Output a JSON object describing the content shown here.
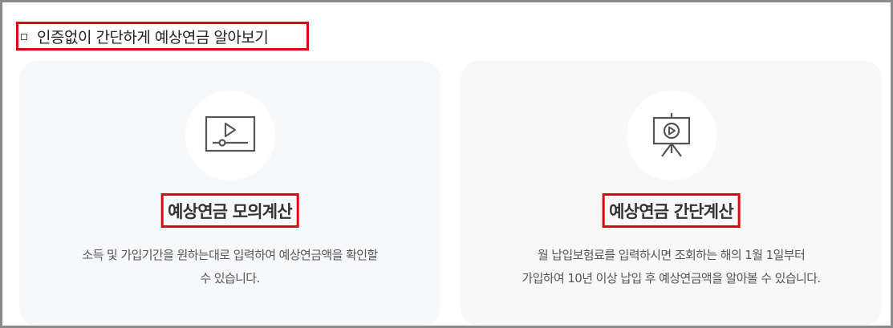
{
  "section": {
    "title": "인증없이 간단하게 예상연금 알아보기"
  },
  "cards": [
    {
      "icon": "video-player-icon",
      "title": "예상연금 모의계산",
      "desc_line1": "소득 및 가입기간을 원하는대로 입력하여 예상연금액을 확인할",
      "desc_line2": "수 있습니다."
    },
    {
      "icon": "presentation-play-icon",
      "title": "예상연금 간단계산",
      "desc_line1": "월 납입보험료를 입력하시면 조회하는 해의 1월 1일부터",
      "desc_line2": "가입하여 10년 이상 납입 후 예상연금액을 알아볼 수 있습니다."
    }
  ],
  "colors": {
    "highlight": "#e0000f",
    "card_bg": "#f7f8fa",
    "text": "#333333"
  }
}
